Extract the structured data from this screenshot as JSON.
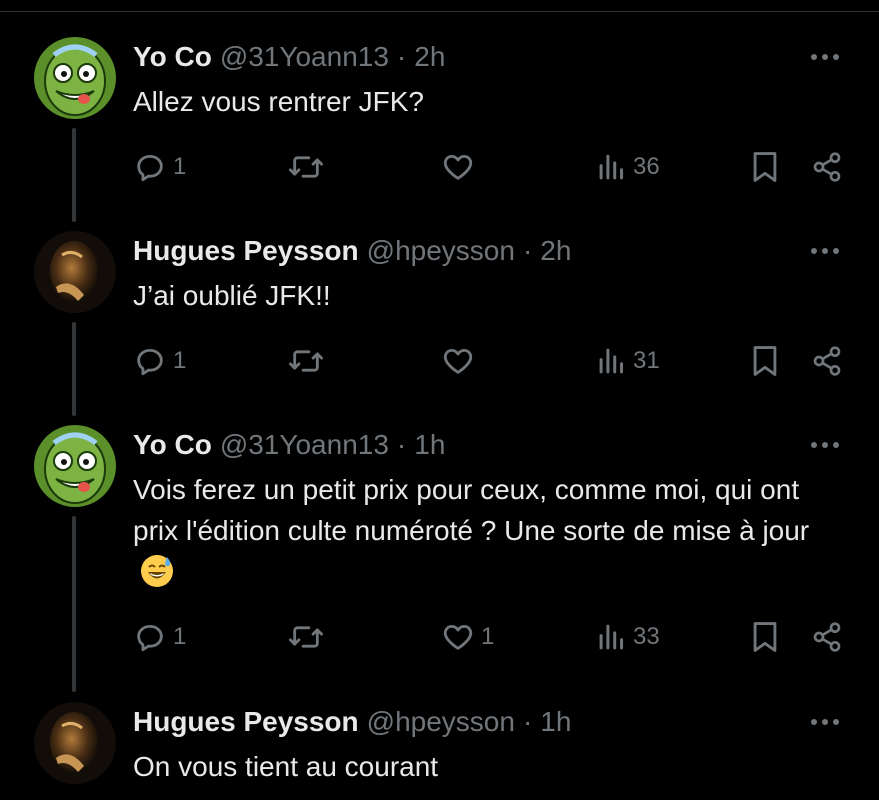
{
  "theme": {
    "background": "#000000",
    "text": "#e7e9ea",
    "muted": "#71767b",
    "thread_line": "#333639"
  },
  "tweets": [
    {
      "name": "Yo Co",
      "handle": "@31Yoann13",
      "separator": "·",
      "time": "2h",
      "text": "Allez vous rentrer JFK?",
      "avatar": "rick-pickle-avatar",
      "replies": "1",
      "retweets": "",
      "likes": "",
      "views": "36"
    },
    {
      "name": "Hugues Peysson",
      "handle": "@hpeysson",
      "separator": "·",
      "time": "2h",
      "text": "J’ai oublié JFK!!",
      "avatar": "dark-photo-avatar",
      "replies": "1",
      "retweets": "",
      "likes": "",
      "views": "31"
    },
    {
      "name": "Yo Co",
      "handle": "@31Yoann13",
      "separator": "·",
      "time": "1h",
      "text": "Vois ferez un petit prix pour ceux, comme moi, qui ont prix l'édition culte numéroté ? Une sorte de mise à jour",
      "emoji": "grinning-sweat-emoji",
      "avatar": "rick-pickle-avatar",
      "replies": "1",
      "retweets": "",
      "likes": "1",
      "views": "33"
    },
    {
      "name": "Hugues Peysson",
      "handle": "@hpeysson",
      "separator": "·",
      "time": "1h",
      "text": "On vous tient au courant",
      "avatar": "dark-photo-avatar"
    }
  ],
  "icons": {
    "reply": "reply-icon",
    "retweet": "retweet-icon",
    "like": "heart-icon",
    "views": "views-icon",
    "bookmark": "bookmark-icon",
    "share": "share-icon",
    "more": "more-options-icon"
  }
}
